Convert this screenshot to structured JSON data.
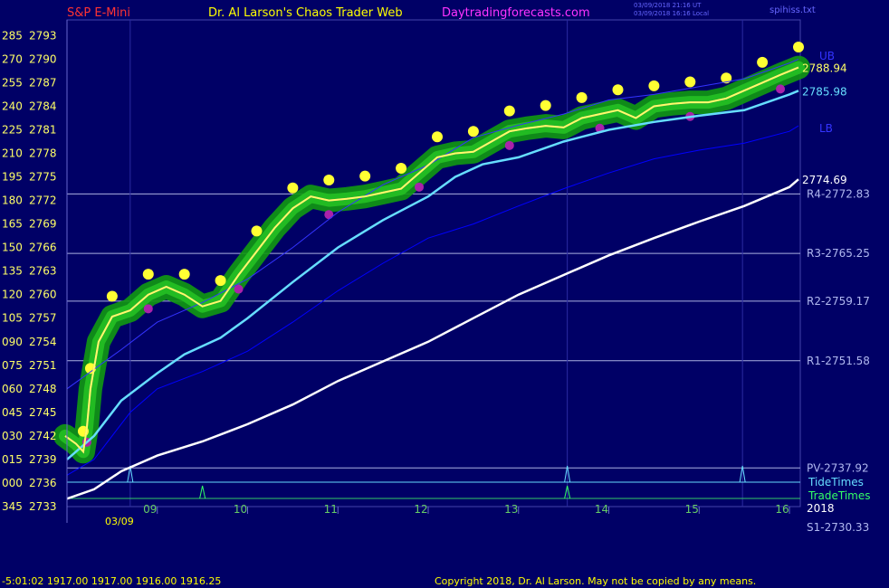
{
  "header": {
    "instrument": "S&P E-Mini",
    "site": "Dr. Al Larson's Chaos Trader Web",
    "url": "Daytradingforecasts.com",
    "utc_stamp": "03/09/2018 21:16 UT",
    "local_stamp": "03/09/2018 16:16 Local",
    "file": "spihiss.txt"
  },
  "footer": {
    "quote": "-5:01:02  1917.00  1917.00  1916.00  1916.25",
    "copyright": "Copyright 2018, Dr. Al Larson. May not be copied by any means."
  },
  "chart_data": {
    "type": "line",
    "date_label": "03/09",
    "year_label": "2018",
    "x_ticks": [
      {
        "h": 9,
        "label": "09"
      },
      {
        "h": 10,
        "label": "10"
      },
      {
        "h": 11,
        "label": "11"
      },
      {
        "h": 12,
        "label": "12"
      },
      {
        "h": 13,
        "label": "13"
      },
      {
        "h": 14,
        "label": "14"
      },
      {
        "h": 15,
        "label": "15"
      },
      {
        "h": 16,
        "label": "16"
      }
    ],
    "x_range": [
      8.0,
      16.12
    ],
    "y_range": [
      2733,
      2795
    ],
    "y_ticks": [
      {
        "deg": "285",
        "price": "2793",
        "v": 2793
      },
      {
        "deg": "270",
        "price": "2790",
        "v": 2790
      },
      {
        "deg": "255",
        "price": "2787",
        "v": 2787
      },
      {
        "deg": "240",
        "price": "2784",
        "v": 2784
      },
      {
        "deg": "225",
        "price": "2781",
        "v": 2781
      },
      {
        "deg": "210",
        "price": "2778",
        "v": 2778
      },
      {
        "deg": "195",
        "price": "2775",
        "v": 2775
      },
      {
        "deg": "180",
        "price": "2772",
        "v": 2772
      },
      {
        "deg": "165",
        "price": "2769",
        "v": 2769
      },
      {
        "deg": "150",
        "price": "2766",
        "v": 2766
      },
      {
        "deg": "135",
        "price": "2763",
        "v": 2763
      },
      {
        "deg": "120",
        "price": "2760",
        "v": 2760
      },
      {
        "deg": "105",
        "price": "2757",
        "v": 2757
      },
      {
        "deg": "090",
        "price": "2754",
        "v": 2754
      },
      {
        "deg": "075",
        "price": "2751",
        "v": 2751
      },
      {
        "deg": "060",
        "price": "2748",
        "v": 2748
      },
      {
        "deg": "045",
        "price": "2745",
        "v": 2745
      },
      {
        "deg": "030",
        "price": "2742",
        "v": 2742
      },
      {
        "deg": "015",
        "price": "2739",
        "v": 2739
      },
      {
        "deg": "000",
        "price": "2736",
        "v": 2736
      },
      {
        "deg": "345",
        "price": "2733",
        "v": 2733
      }
    ],
    "pivot_levels": [
      {
        "label": "R4-2772.83",
        "value": 2772.83
      },
      {
        "label": "R3-2765.25",
        "value": 2765.25
      },
      {
        "label": "R2-2759.17",
        "value": 2759.17
      },
      {
        "label": "R1-2751.58",
        "value": 2751.58
      },
      {
        "label": "PV-2737.92",
        "value": 2737.92
      },
      {
        "label": "S1-2730.33",
        "value": 2730.33
      }
    ],
    "band_labels": {
      "upper": "UB",
      "lower": "LB"
    },
    "last_values": [
      {
        "label": "2788.94",
        "value": 2788.94,
        "color": "#ffff66"
      },
      {
        "label": "2785.98",
        "value": 2785.98,
        "color": "#66ddff"
      },
      {
        "label": "2774.69",
        "value": 2774.69,
        "color": "#ffffff"
      }
    ],
    "timing_lines": {
      "tide_label": "TideTimes",
      "trade_label": "TradeTimes",
      "tide_spikes_h": [
        8.7,
        13.54,
        15.48
      ],
      "trade_spikes_h": [
        9.5,
        13.54
      ]
    },
    "series": [
      {
        "name": "",
        "color": "#ffffff",
        "x": [
          8.0,
          8.3,
          8.6,
          9.0,
          9.5,
          10.0,
          10.5,
          11.0,
          11.5,
          12.0,
          12.5,
          13.0,
          13.5,
          14.0,
          14.5,
          15.0,
          15.5,
          16.0,
          16.1
        ],
        "values": [
          2734.0,
          2735.2,
          2737.5,
          2739.5,
          2741.3,
          2743.5,
          2746.0,
          2749.0,
          2751.5,
          2754.0,
          2757.0,
          2760.0,
          2762.5,
          2765.0,
          2767.2,
          2769.3,
          2771.3,
          2773.7,
          2774.69
        ]
      },
      {
        "name": "",
        "color": "#0000ff",
        "x": [
          8.0,
          8.3,
          8.7,
          9.0,
          9.5,
          10.0,
          10.5,
          11.0,
          11.5,
          12.0,
          12.5,
          13.0,
          13.5,
          14.0,
          14.5,
          15.0,
          15.5,
          16.0,
          16.1
        ],
        "values": [
          2737.0,
          2739.0,
          2745.0,
          2748.0,
          2750.2,
          2752.8,
          2756.5,
          2760.5,
          2764.0,
          2767.2,
          2769.0,
          2771.3,
          2773.5,
          2775.5,
          2777.3,
          2778.4,
          2779.3,
          2780.8,
          2781.5
        ]
      },
      {
        "name": "",
        "color": "#66ddff",
        "x": [
          8.0,
          8.3,
          8.6,
          9.0,
          9.3,
          9.7,
          10.0,
          10.5,
          11.0,
          11.5,
          12.0,
          12.3,
          12.6,
          13.0,
          13.5,
          14.0,
          14.5,
          15.0,
          15.5,
          16.0,
          16.1
        ],
        "values": [
          2739.0,
          2742.0,
          2746.5,
          2750.0,
          2752.4,
          2754.5,
          2757.0,
          2761.6,
          2766.0,
          2769.5,
          2772.5,
          2775.0,
          2776.6,
          2777.5,
          2779.5,
          2781.0,
          2782.0,
          2782.8,
          2783.5,
          2785.5,
          2785.98
        ]
      },
      {
        "name": "",
        "color": "#3333ff",
        "x": [
          8.0,
          8.6,
          9.0,
          9.5,
          10.0,
          10.5,
          11.0,
          11.5,
          12.0,
          12.5,
          13.0,
          13.5,
          14.0,
          14.5,
          15.0,
          15.5,
          16.0,
          16.1
        ],
        "values": [
          2748.0,
          2753.0,
          2756.5,
          2759.0,
          2762.0,
          2766.0,
          2770.5,
          2774.0,
          2776.5,
          2780.0,
          2781.6,
          2783.0,
          2784.8,
          2785.5,
          2786.5,
          2787.5,
          2789.5,
          2790.0
        ]
      },
      {
        "name": "",
        "color": "#ffff66",
        "x": [
          7.98,
          8.1,
          8.18,
          8.22,
          8.26,
          8.35,
          8.5,
          8.7,
          8.9,
          9.1,
          9.3,
          9.5,
          9.7,
          9.9,
          10.1,
          10.3,
          10.5,
          10.7,
          10.9,
          11.1,
          11.3,
          11.5,
          11.7,
          11.9,
          12.1,
          12.3,
          12.5,
          12.7,
          12.9,
          13.1,
          13.3,
          13.5,
          13.7,
          13.9,
          14.1,
          14.3,
          14.5,
          14.7,
          14.9,
          15.1,
          15.3,
          15.5,
          15.7,
          15.9,
          16.1
        ],
        "values": [
          2742.0,
          2741.0,
          2740.0,
          2743.0,
          2748.0,
          2754.0,
          2757.2,
          2758.0,
          2760.0,
          2761.0,
          2760.0,
          2758.5,
          2759.2,
          2762.5,
          2765.5,
          2768.5,
          2771.0,
          2772.5,
          2772.0,
          2772.2,
          2772.5,
          2773.0,
          2773.5,
          2775.5,
          2777.5,
          2778.0,
          2778.2,
          2779.5,
          2780.8,
          2781.2,
          2781.5,
          2781.3,
          2782.5,
          2783.0,
          2783.5,
          2782.5,
          2784.0,
          2784.3,
          2784.5,
          2784.5,
          2785.0,
          2786.0,
          2787.0,
          2788.0,
          2788.94
        ]
      }
    ]
  }
}
